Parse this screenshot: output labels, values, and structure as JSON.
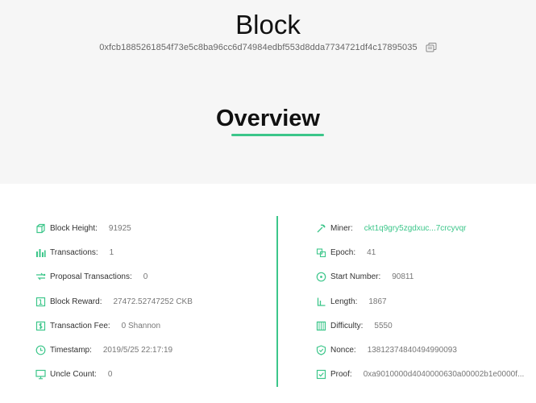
{
  "header": {
    "title": "Block",
    "hash": "0xfcb1885261854f73e5c8ba96cc6d74984edbf553d8dda7734721df4c17895035",
    "section_title": "Overview"
  },
  "overview": {
    "left": [
      {
        "label": "Block Height:",
        "value": "91925",
        "icon": "cube-icon"
      },
      {
        "label": "Transactions:",
        "value": "1",
        "icon": "bar-chart-icon"
      },
      {
        "label": "Proposal Transactions:",
        "value": "0",
        "icon": "proposal-icon"
      },
      {
        "label": "Block Reward:",
        "value": "27472.52747252 CKB",
        "icon": "reward-icon"
      },
      {
        "label": "Transaction Fee:",
        "value": "0 Shannon",
        "icon": "dollar-icon"
      },
      {
        "label": "Timestamp:",
        "value": "2019/5/25 22:17:19",
        "icon": "clock-icon"
      },
      {
        "label": "Uncle Count:",
        "value": "0",
        "icon": "monitor-icon"
      }
    ],
    "right": [
      {
        "label": "Miner:",
        "value": "ckt1q9gry5zgdxuc...7crcyvqr",
        "icon": "pickaxe-icon"
      },
      {
        "label": "Epoch:",
        "value": "41",
        "icon": "epoch-icon"
      },
      {
        "label": "Start Number:",
        "value": "90811",
        "icon": "start-icon"
      },
      {
        "label": "Length:",
        "value": "1867",
        "icon": "length-icon"
      },
      {
        "label": "Difficulty:",
        "value": "5550",
        "icon": "difficulty-icon"
      },
      {
        "label": "Nonce:",
        "value": "13812374840494990093",
        "icon": "shield-icon"
      },
      {
        "label": "Proof:",
        "value": "0xa9010000d4040000630a00002b1e0000f...",
        "icon": "proof-icon"
      }
    ]
  },
  "colors": {
    "accent": "#3cc68a",
    "background": "#f6f6f6",
    "panel": "#ffffff"
  }
}
